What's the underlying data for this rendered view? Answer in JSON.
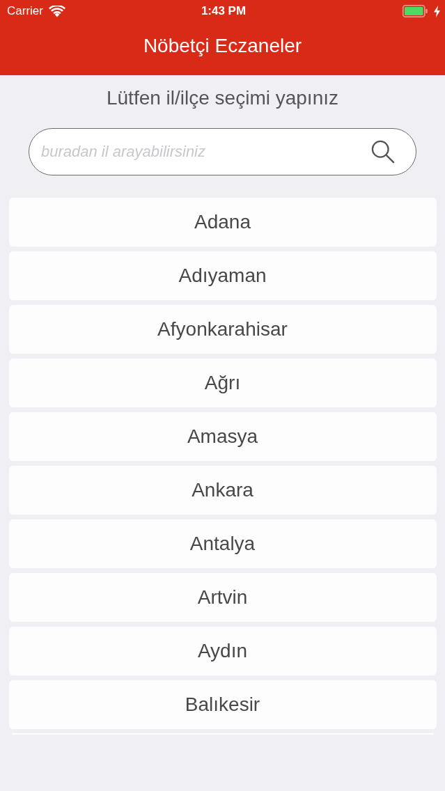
{
  "status_bar": {
    "carrier": "Carrier",
    "time": "1:43 PM"
  },
  "nav_bar": {
    "title": "Nöbetçi Eczaneler"
  },
  "prompt": "Lütfen il/ilçe seçimi yapınız",
  "search": {
    "placeholder": "buradan il arayabilirsiniz"
  },
  "cities": [
    "Adana",
    "Adıyaman",
    "Afyonkarahisar",
    "Ağrı",
    "Amasya",
    "Ankara",
    "Antalya",
    "Artvin",
    "Aydın",
    "Balıkesir"
  ]
}
